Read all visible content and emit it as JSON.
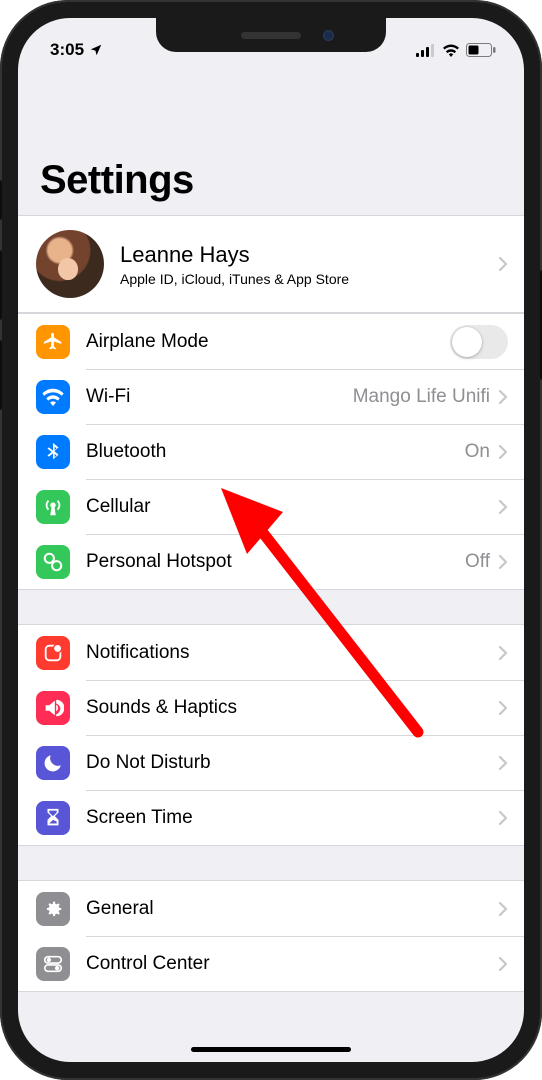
{
  "status": {
    "time": "3:05",
    "location_icon": "location-arrow",
    "cell_bars": 4,
    "wifi": true,
    "battery_level": 45
  },
  "title": "Settings",
  "profile": {
    "name": "Leanne Hays",
    "subtitle": "Apple ID, iCloud, iTunes & App Store"
  },
  "groups": [
    {
      "items": [
        {
          "icon": "airplane-icon",
          "icon_bg": "bg-orange",
          "label": "Airplane Mode",
          "control": "toggle",
          "toggle_on": false
        },
        {
          "icon": "wifi-icon",
          "icon_bg": "bg-blue",
          "label": "Wi-Fi",
          "control": "disclosure",
          "value": "Mango Life Unifi"
        },
        {
          "icon": "bluetooth-icon",
          "icon_bg": "bg-blue",
          "label": "Bluetooth",
          "control": "disclosure",
          "value": "On"
        },
        {
          "icon": "cellular-icon",
          "icon_bg": "bg-green",
          "label": "Cellular",
          "control": "disclosure",
          "value": ""
        },
        {
          "icon": "hotspot-icon",
          "icon_bg": "bg-green",
          "label": "Personal Hotspot",
          "control": "disclosure",
          "value": "Off"
        }
      ]
    },
    {
      "items": [
        {
          "icon": "notifications-icon",
          "icon_bg": "bg-red",
          "label": "Notifications",
          "control": "disclosure",
          "value": ""
        },
        {
          "icon": "sounds-icon",
          "icon_bg": "bg-pink",
          "label": "Sounds & Haptics",
          "control": "disclosure",
          "value": ""
        },
        {
          "icon": "moon-icon",
          "icon_bg": "bg-indigo",
          "label": "Do Not Disturb",
          "control": "disclosure",
          "value": ""
        },
        {
          "icon": "hourglass-icon",
          "icon_bg": "bg-indigo",
          "label": "Screen Time",
          "control": "disclosure",
          "value": ""
        }
      ]
    },
    {
      "items": [
        {
          "icon": "gear-icon",
          "icon_bg": "bg-gray",
          "label": "General",
          "control": "disclosure",
          "value": ""
        },
        {
          "icon": "switches-icon",
          "icon_bg": "bg-graylt",
          "label": "Control Center",
          "control": "disclosure",
          "value": ""
        }
      ]
    }
  ],
  "annotation": {
    "target_label": "Bluetooth",
    "color": "#ff0000"
  }
}
